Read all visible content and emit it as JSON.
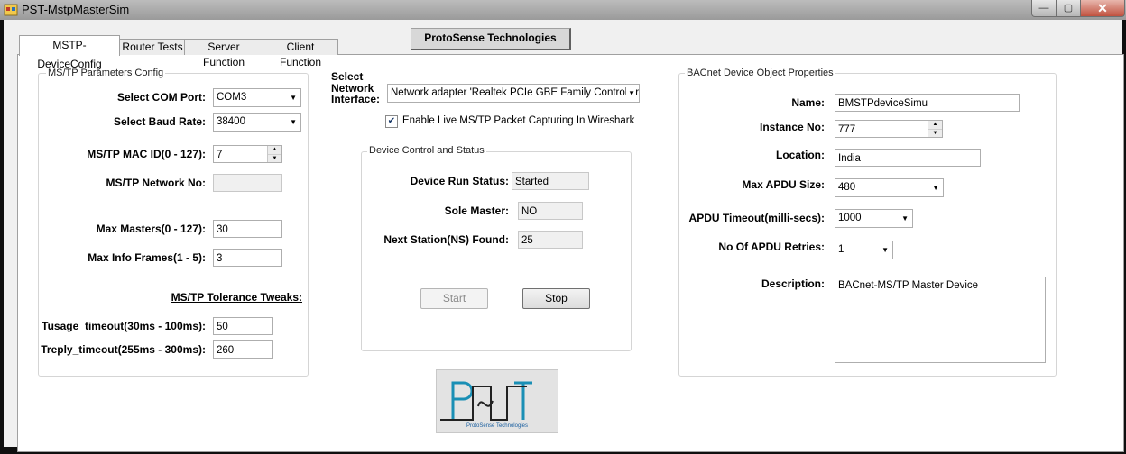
{
  "window": {
    "title": "PST-MstpMasterSim",
    "min": "—",
    "max": "▢",
    "close": "✕"
  },
  "header": {
    "brand": "ProtoSense Technologies"
  },
  "tabs": [
    "MSTP-DeviceConfig",
    "Router Tests",
    "Server Function",
    "Client Function"
  ],
  "mstp": {
    "group_title": "MS/TP Parameters Config",
    "com_port_label": "Select COM Port:",
    "com_port_value": "COM3",
    "baud_label": "Select Baud Rate:",
    "baud_value": "38400",
    "mac_label": "MS/TP MAC ID(0 - 127):",
    "mac_value": "7",
    "network_label": "MS/TP Network No:",
    "network_value": "",
    "max_masters_label": "Max Masters(0 - 127):",
    "max_masters_value": "30",
    "max_info_label": "Max Info Frames(1 - 5):",
    "max_info_value": "3",
    "tolerance_title": "MS/TP Tolerance Tweaks:",
    "tusage_label": "Tusage_timeout(30ms - 100ms):",
    "tusage_value": "50",
    "treply_label": "Treply_timeout(255ms - 300ms):",
    "treply_value": "260"
  },
  "network": {
    "label_line1": "Select",
    "label_line2": "Network",
    "label_line3": "Interface:",
    "interface_value": "Network adapter 'Realtek PCIe GBE Family Controller' c",
    "wireshark_label": "Enable Live MS/TP Packet Capturing In Wireshark",
    "wireshark_checked": true
  },
  "device_control": {
    "group_title": "Device Control and Status",
    "run_status_label": "Device Run Status:",
    "run_status_value": "Started",
    "sole_master_label": "Sole Master:",
    "sole_master_value": "NO",
    "next_station_label": "Next Station(NS) Found:",
    "next_station_value": "25",
    "start_label": "Start",
    "stop_label": "Stop"
  },
  "bacnet": {
    "group_title": "BACnet Device Object Properties",
    "name_label": "Name:",
    "name_value": "BMSTPdeviceSimu",
    "instance_label": "Instance No:",
    "instance_value": "777",
    "location_label": "Location:",
    "location_value": "India",
    "apdu_size_label": "Max APDU Size:",
    "apdu_size_value": "480",
    "apdu_timeout_label": "APDU Timeout(milli-secs):",
    "apdu_timeout_value": "1000",
    "apdu_retries_label": "No Of APDU Retries:",
    "apdu_retries_value": "1",
    "description_label": "Description:",
    "description_value": "BACnet-MS/TP Master Device"
  },
  "logo": {
    "text": "ProtoSense Technologies"
  },
  "colors": {
    "accent": "#1a8fb5",
    "window_chrome": "#9a9a9a",
    "close_button": "#c0513f"
  },
  "icons": {
    "checkbox": "check-icon",
    "dropdown": "chevron-down-icon",
    "spinner": "spinner-arrows-icon"
  }
}
